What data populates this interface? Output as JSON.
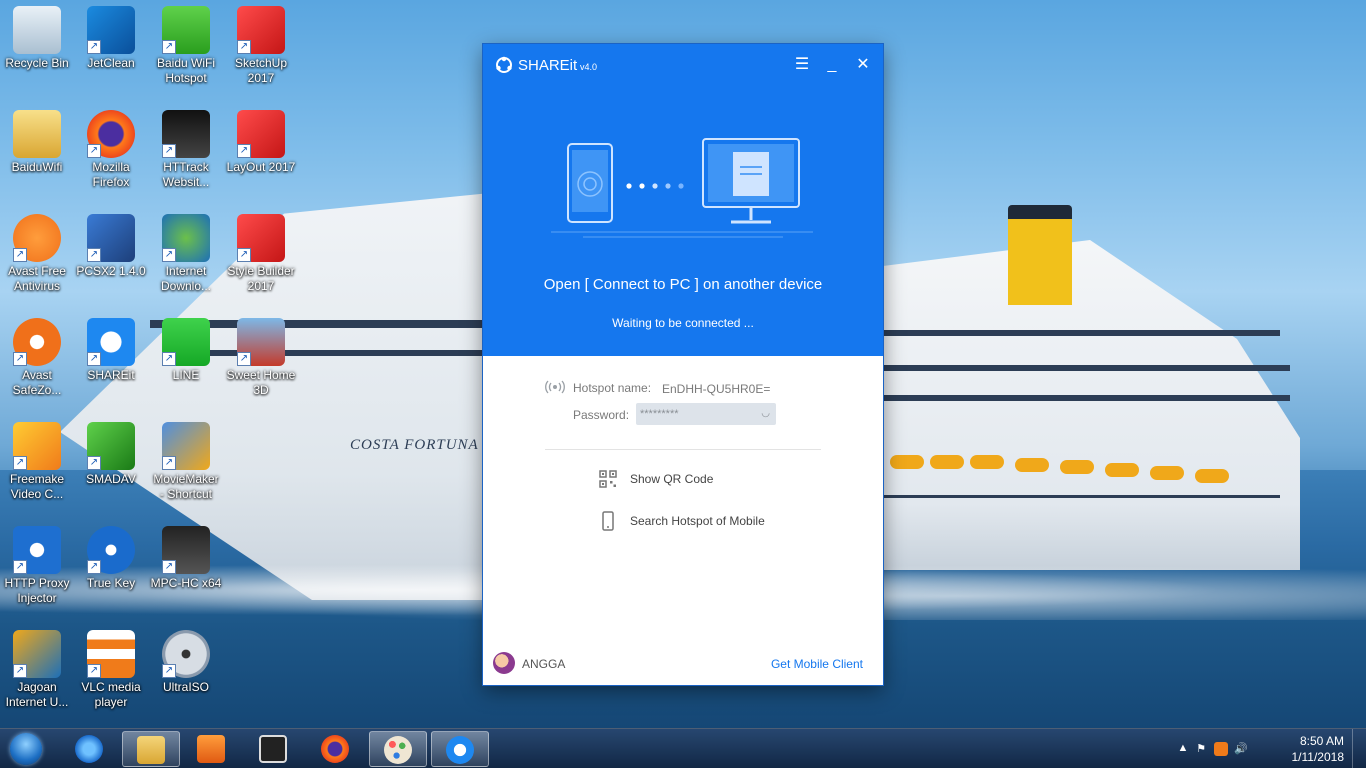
{
  "desktop": {
    "icons": [
      {
        "label": "Recycle Bin",
        "icon": "recycle-bin-icon"
      },
      {
        "label": "JetClean",
        "icon": "jetclean-icon"
      },
      {
        "label": "Baidu WiFi\nHotspot",
        "icon": "baidu-wifi-icon"
      },
      {
        "label": "SketchUp\n2017",
        "icon": "sketchup-icon"
      },
      {
        "label": "BaiduWifi",
        "icon": "folder-icon"
      },
      {
        "label": "Mozilla\nFirefox",
        "icon": "firefox-icon"
      },
      {
        "label": "HTTrack\nWebsit...",
        "icon": "httrack-icon"
      },
      {
        "label": "LayOut 2017",
        "icon": "layout-icon"
      },
      {
        "label": "Avast Free\nAntivirus",
        "icon": "avast-icon"
      },
      {
        "label": "PCSX2 1.4.0",
        "icon": "pcsx2-icon"
      },
      {
        "label": "Internet\nDownlo...",
        "icon": "idm-icon"
      },
      {
        "label": "Style Builder\n2017",
        "icon": "style-builder-icon"
      },
      {
        "label": "Avast\nSafeZo...",
        "icon": "avast-safezone-icon"
      },
      {
        "label": "SHAREit",
        "icon": "shareit-icon"
      },
      {
        "label": "LINE",
        "icon": "line-icon"
      },
      {
        "label": "Sweet Home\n3D",
        "icon": "sweet-home-icon"
      },
      {
        "label": "Freemake\nVideo C...",
        "icon": "freemake-icon"
      },
      {
        "label": "SMADAV",
        "icon": "smadav-icon"
      },
      {
        "label": "MovieMaker\n- Shortcut",
        "icon": "moviemaker-icon"
      },
      {
        "label": "HTTP Proxy\nInjector",
        "icon": "http-proxy-icon"
      },
      {
        "label": "True Key",
        "icon": "true-key-icon"
      },
      {
        "label": "MPC-HC x64",
        "icon": "mpc-hc-icon"
      },
      {
        "label": "Jagoan\nInternet U...",
        "icon": "jagoan-icon"
      },
      {
        "label": "VLC media\nplayer",
        "icon": "vlc-icon"
      },
      {
        "label": "UltraISO",
        "icon": "ultraiso-icon"
      }
    ]
  },
  "wallpaper": {
    "ship_name": "COSTA FORTUNA"
  },
  "shareit": {
    "app_name": "SHAREit",
    "version": "v4.0",
    "open_text": "Open [ Connect to PC ] on another device",
    "wait_text": "Waiting to be connected ...",
    "hotspot_label": "Hotspot name:",
    "hotspot_value": "EnDHH-QU5HR0E=",
    "password_label": "Password:",
    "password_value": "*********",
    "show_qr": "Show QR Code",
    "search_hotspot": "Search Hotspot of Mobile",
    "user_name": "ANGGA",
    "get_mobile": "Get Mobile Client",
    "accent": "#1577ee"
  },
  "taskbar": {
    "items": [
      {
        "name": "internet-explorer-icon"
      },
      {
        "name": "file-explorer-icon"
      },
      {
        "name": "media-player-icon"
      },
      {
        "name": "mpc-hc-icon"
      },
      {
        "name": "firefox-icon"
      },
      {
        "name": "paint-icon"
      },
      {
        "name": "shareit-icon"
      }
    ],
    "time": "8:50 AM",
    "date": "1/11/2018"
  }
}
